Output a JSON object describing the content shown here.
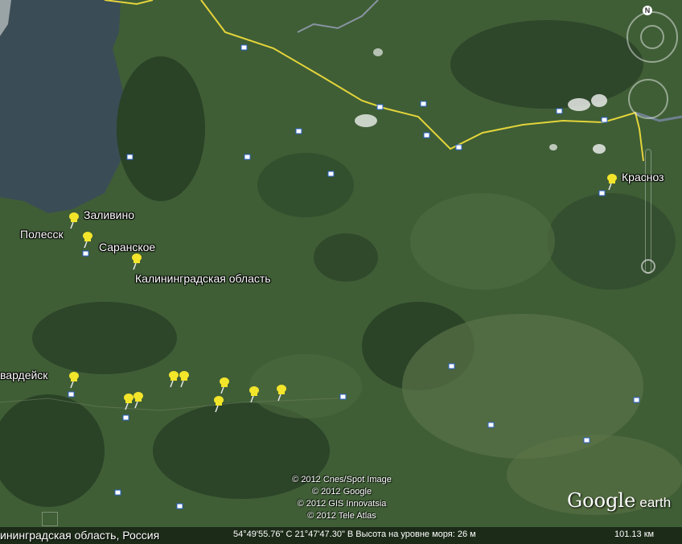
{
  "map": {
    "labels": {
      "zalivino": "Заливино",
      "polessk": "Полесск",
      "saranskoe": "Саранское",
      "region": "Калининградская область",
      "gvardeysk": "вардейск",
      "krasnoz": "Красноз"
    },
    "credits": [
      "© 2012 Cnes/Spot Image",
      "© 2012 Google",
      "© 2012 GIS Innovatsia",
      "© 2012 Tele Atlas"
    ],
    "logo": {
      "google": "Google",
      "earth": "earth"
    },
    "nav": {
      "north": "N"
    }
  },
  "status": {
    "region": "ининградская область, Россия",
    "coords": "54°49'55.76\" С  21°47'47.30\" В Высота на уровне моря: 26 м",
    "elevation": "101.13 км"
  },
  "colors": {
    "pin": "#f3e52a",
    "border": "#e3d43a",
    "water": "#3b4d55",
    "forest": "#2c4428",
    "field": "#4d6b3f"
  }
}
